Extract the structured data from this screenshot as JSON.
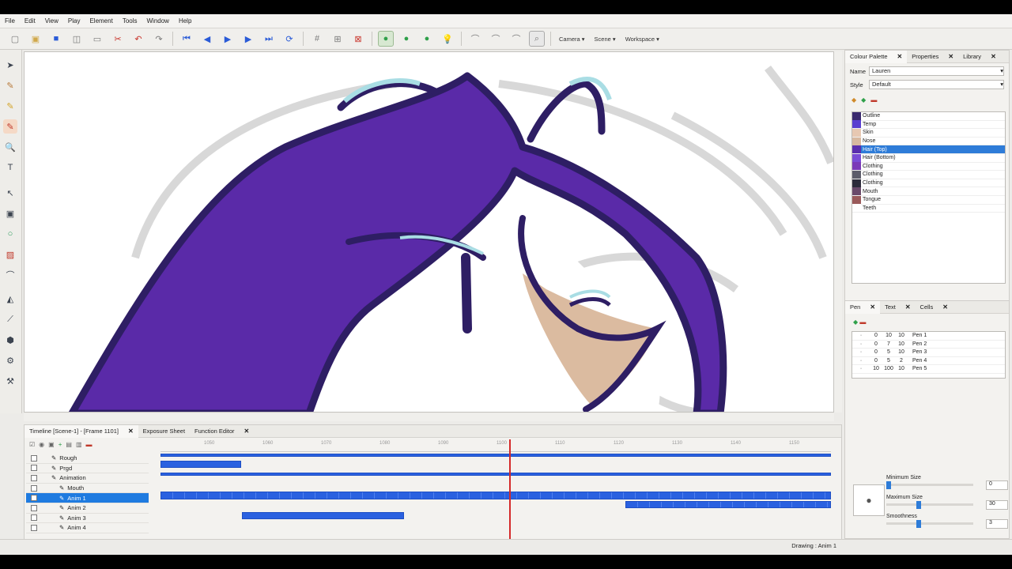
{
  "menu": [
    "File",
    "Edit",
    "View",
    "Play",
    "Element",
    "Tools",
    "Window",
    "Help"
  ],
  "toolbar": {
    "camera_label": "Camera",
    "scene_label": "Scene",
    "workspace_label": "Workspace"
  },
  "colour_panel": {
    "tabs": [
      "Colour Palette",
      "Properties",
      "Library"
    ],
    "name_label": "Name",
    "name_value": "Lauren",
    "style_label": "Style",
    "style_value": "Default",
    "swatches": [
      {
        "label": "Outline",
        "color": "#3a2a6e"
      },
      {
        "label": "Temp",
        "color": "#5a3fd0"
      },
      {
        "label": "Skin",
        "color": "#e7c8b2"
      },
      {
        "label": "Nose",
        "color": "#d8b9a0"
      },
      {
        "label": "Hair (Top)",
        "color": "#5a2fae"
      },
      {
        "label": "Hair (Bottom)",
        "color": "#7a4dd6"
      },
      {
        "label": "Clothing",
        "color": "#7b3ab8"
      },
      {
        "label": "Clothing",
        "color": "#5c5c6a"
      },
      {
        "label": "Clothing",
        "color": "#2c2c3a"
      },
      {
        "label": "Mouth",
        "color": "#6a4a6a"
      },
      {
        "label": "Tongue",
        "color": "#9a5a5a"
      },
      {
        "label": "Teeth",
        "color": "#ffffff"
      }
    ],
    "selected_index": 4
  },
  "pen_panel": {
    "tabs": [
      "Pen",
      "Text",
      "Cells"
    ],
    "rows": [
      {
        "a": "0",
        "b": "10",
        "c": "10",
        "name": "Pen 1"
      },
      {
        "a": "0",
        "b": "7",
        "c": "10",
        "name": "Pen 2"
      },
      {
        "a": "0",
        "b": "5",
        "c": "10",
        "name": "Pen 3"
      },
      {
        "a": "0",
        "b": "5",
        "c": "2",
        "name": "Pen 4"
      },
      {
        "a": "10",
        "b": "100",
        "c": "10",
        "name": "Pen 5"
      }
    ],
    "min_size_label": "Minimum Size",
    "min_size_value": "0",
    "max_size_label": "Maximum Size",
    "max_size_value": "30",
    "smooth_label": "Smoothness",
    "smooth_value": "3"
  },
  "timeline": {
    "tabs": [
      "Timeline [Scene-1] - [Frame 1101]",
      "Exposure Sheet",
      "Function Editor"
    ],
    "ticks": [
      "1050",
      "1060",
      "1070",
      "1080",
      "1090",
      "1100",
      "1110",
      "1120",
      "1130",
      "1140",
      "1150"
    ],
    "layers": [
      {
        "name": "Rough",
        "indent": 1
      },
      {
        "name": "Prgd",
        "indent": 1
      },
      {
        "name": "Animation",
        "indent": 1
      },
      {
        "name": "Mouth",
        "indent": 2
      },
      {
        "name": "Anim 1",
        "indent": 2
      },
      {
        "name": "Anim 2",
        "indent": 2
      },
      {
        "name": "Anim 3",
        "indent": 2
      },
      {
        "name": "Anim 4",
        "indent": 2
      }
    ],
    "selected_layer": 4,
    "playhead_position": 0.52
  },
  "status": {
    "text": "Drawing : Anim 1"
  },
  "colors": {
    "accent": "#2a61e0",
    "selection": "#1f7be0",
    "playhead": "#d42a2a"
  }
}
